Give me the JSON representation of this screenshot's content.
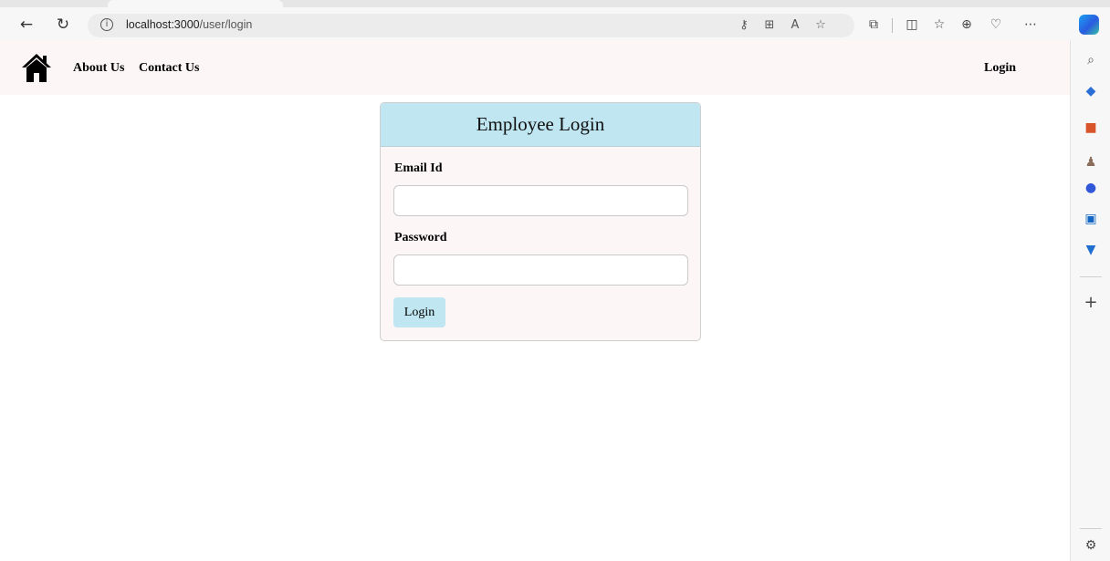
{
  "browser": {
    "address": {
      "host": "localhost:3000",
      "path": "/user/login"
    }
  },
  "colors": {
    "navbar_bg": "#fcf6f7",
    "card_header_bg": "#bfe6f1",
    "button_bg": "#bfe6f1"
  },
  "navbar": {
    "home_icon": "home-icon",
    "links": [
      "About Us",
      "Contact Us"
    ],
    "login_label": "Login"
  },
  "login_card": {
    "title": "Employee Login",
    "email_label": "Email Id",
    "email_value": "",
    "password_label": "Password",
    "password_value": "",
    "submit_label": "Login"
  }
}
